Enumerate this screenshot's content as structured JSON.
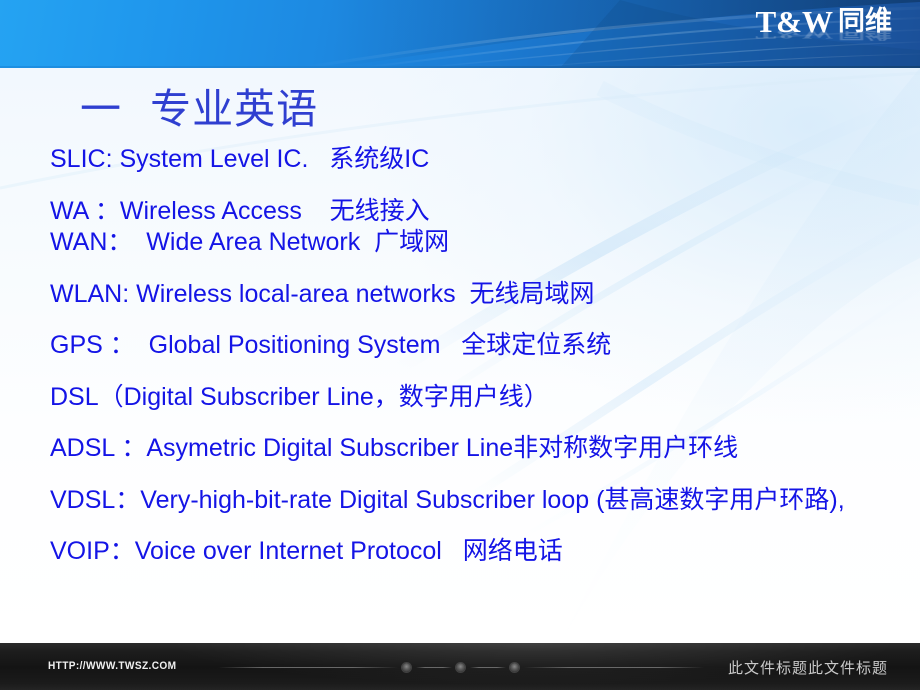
{
  "header": {
    "logo_main": "T&W",
    "logo_cn": "同维",
    "brand_blue_light": "#25a3f2",
    "brand_blue_dark": "#1b5099"
  },
  "slide": {
    "title": "一  专业英语",
    "title_color": "#2f3fd0",
    "body_color": "#1414e6",
    "lines": [
      "SLIC: System Level IC.   系统级IC",
      "WA ：Wireless Access    无线接入",
      "WAN：  Wide Area Network  广域网",
      "WLAN: Wireless local-area networks  无线局域网",
      "GPS ：  Global Positioning System   全球定位系统",
      "DSL（Digital Subscriber Line，数字用户线）",
      "ADSL ：Asymetric Digital Subscriber Line非对称数字用户环线",
      "VDSL：Very-high-bit-rate Digital Subscriber loop (甚高速数字用户环路),",
      "VOIP：Voice over Internet Protocol   网络电话"
    ]
  },
  "footer": {
    "url": "HTTP://WWW.TWSZ.COM",
    "doc_title": "此文件标题此文件标题",
    "background": "#141414",
    "dot_count": 3
  }
}
